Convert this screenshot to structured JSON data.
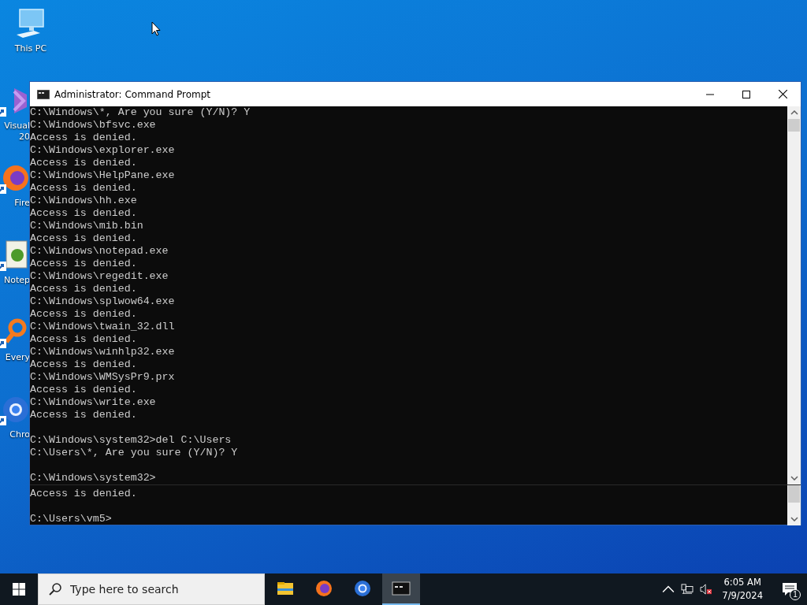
{
  "desktop": {
    "icons": [
      {
        "kind": "computer",
        "label_lines": [
          "This PC"
        ]
      },
      {
        "kind": "visual-studio",
        "label_lines": [
          "Visual",
          "20"
        ]
      },
      {
        "kind": "firefox",
        "label_lines": [
          "Fire"
        ]
      },
      {
        "kind": "notepad",
        "label_lines": [
          "Notep"
        ]
      },
      {
        "kind": "everything",
        "label_lines": [
          "Every"
        ]
      },
      {
        "kind": "chrome",
        "label_lines": [
          "Chro"
        ]
      }
    ]
  },
  "window": {
    "title": "Administrator: Command Prompt",
    "upper_pane": {
      "blocks": [
        [
          "C:\\Windows\\*, Are you sure (Y/N)? Y",
          "C:\\Windows\\bfsvc.exe",
          "Access is denied.",
          "C:\\Windows\\explorer.exe",
          "Access is denied.",
          "C:\\Windows\\HelpPane.exe",
          "Access is denied.",
          "C:\\Windows\\hh.exe",
          "Access is denied.",
          "C:\\Windows\\mib.bin",
          "Access is denied.",
          "C:\\Windows\\notepad.exe",
          "Access is denied.",
          "C:\\Windows\\regedit.exe",
          "Access is denied.",
          "C:\\Windows\\splwow64.exe",
          "Access is denied.",
          "C:\\Windows\\twain_32.dll",
          "Access is denied.",
          "C:\\Windows\\winhlp32.exe",
          "Access is denied.",
          "C:\\Windows\\WMSysPr9.prx",
          "Access is denied.",
          "C:\\Windows\\write.exe",
          "Access is denied."
        ],
        [
          "C:\\Windows\\system32>del C:\\Users",
          "C:\\Users\\*, Are you sure (Y/N)? Y"
        ],
        [
          "C:\\Windows\\system32>"
        ]
      ]
    },
    "lower_pane": {
      "blocks": [
        [
          "Access is denied."
        ],
        [
          "C:\\Users\\vm5>"
        ]
      ]
    }
  },
  "taskbar": {
    "search": {
      "placeholder": "Type here to search"
    },
    "apps": [
      {
        "kind": "explorer",
        "selected": false
      },
      {
        "kind": "firefox",
        "selected": false
      },
      {
        "kind": "chrome",
        "selected": false
      },
      {
        "kind": "terminal",
        "selected": true
      }
    ],
    "clock": {
      "time": "6:05 AM",
      "date": "7/9/2024"
    },
    "notifications": {
      "count": "1"
    }
  }
}
